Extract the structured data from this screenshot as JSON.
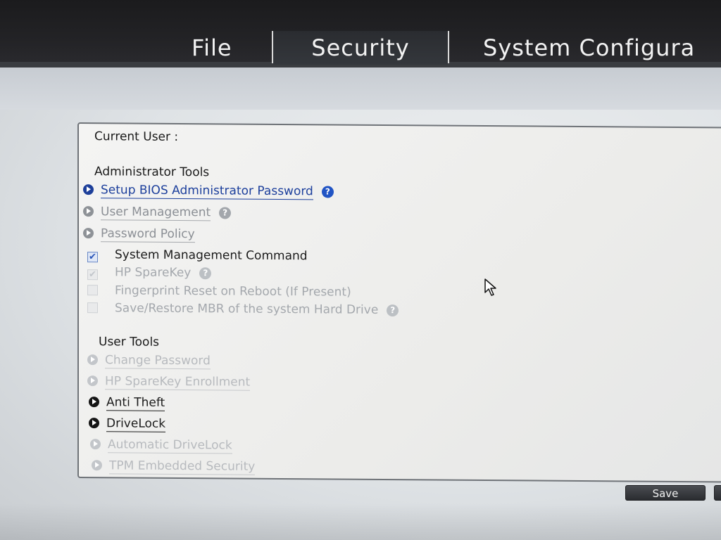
{
  "menu": {
    "tabs": [
      {
        "label": "File"
      },
      {
        "label": "Security"
      },
      {
        "label": "System Configura"
      }
    ]
  },
  "panel": {
    "current_user_label": "Current User :",
    "admin_tools": {
      "heading": "Administrator Tools",
      "links": [
        {
          "label": "Setup BIOS Administrator Password"
        },
        {
          "label": "User Management"
        },
        {
          "label": "Password Policy"
        }
      ],
      "checkboxes": [
        {
          "label": "System Management Command",
          "checked": true,
          "enabled": true
        },
        {
          "label": "HP SpareKey",
          "checked": true,
          "enabled": false
        },
        {
          "label": "Fingerprint Reset on Reboot (If Present)",
          "checked": false,
          "enabled": false
        },
        {
          "label": "Save/Restore MBR of the system Hard Drive",
          "checked": false,
          "enabled": false
        }
      ]
    },
    "user_tools": {
      "heading": "User Tools",
      "links": [
        {
          "label": "Change Password"
        },
        {
          "label": "HP SpareKey Enrollment"
        },
        {
          "label": "Anti Theft"
        },
        {
          "label": "DriveLock"
        },
        {
          "label": "Automatic DriveLock"
        },
        {
          "label": "TPM Embedded Security"
        }
      ]
    }
  },
  "footer": {
    "save_label": "Save"
  },
  "colors": {
    "menubar": "#1f1f22",
    "selected_link": "#1c3f9c",
    "help_icon": "#2154c4"
  }
}
